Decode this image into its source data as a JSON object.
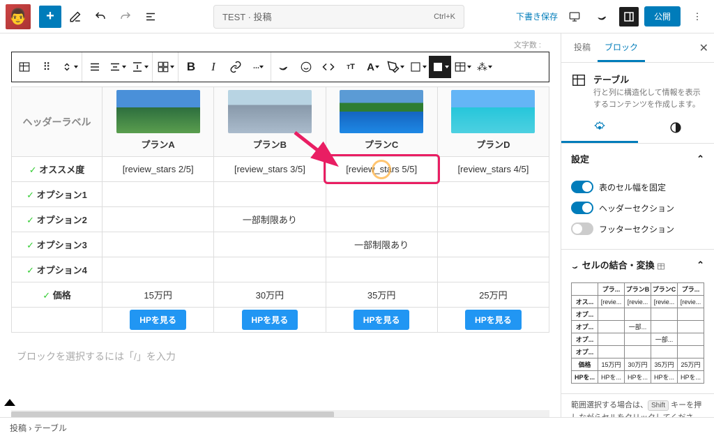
{
  "topbar": {
    "doc_title": "TEST · 投稿",
    "shortcut": "Ctrl+K",
    "draft_save": "下書き保存",
    "publish": "公開"
  },
  "wordcount_label": "文字数 :",
  "table": {
    "header_label": "ヘッダーラベル",
    "plans": [
      "プランA",
      "プランB",
      "プランC",
      "プランD"
    ],
    "rows": [
      {
        "label": "オススメ度",
        "cells": [
          "[review_stars 2/5]",
          "[review_stars 3/5]",
          "[review_stars 5/5]",
          "[review_stars 4/5]"
        ]
      },
      {
        "label": "オプション1",
        "cells": [
          "",
          "",
          "",
          ""
        ]
      },
      {
        "label": "オプション2",
        "cells": [
          "",
          "一部制限あり",
          "",
          ""
        ]
      },
      {
        "label": "オプション3",
        "cells": [
          "",
          "",
          "一部制限あり",
          ""
        ]
      },
      {
        "label": "オプション4",
        "cells": [
          "",
          "",
          "",
          ""
        ]
      },
      {
        "label": "価格",
        "cells": [
          "15万円",
          "30万円",
          "35万円",
          "25万円"
        ]
      }
    ],
    "cta": "HPを見る"
  },
  "placeholder": "ブロックを選択するには「/」を入力",
  "sidebar": {
    "tab_post": "投稿",
    "tab_block": "ブロック",
    "block_title": "テーブル",
    "block_desc": "行と列に構造化して情報を表示するコンテンツを作成します。",
    "panel_settings": "設定",
    "toggle_fixed": "表のセル幅を固定",
    "toggle_header": "ヘッダーセクション",
    "toggle_footer": "フッターセクション",
    "panel_merge": "セルの結合・変換",
    "mini": {
      "cols": [
        "",
        "プラ...",
        "プランB",
        "プランC",
        "プラ..."
      ],
      "rows": [
        [
          "オス...",
          "[revie...",
          "[revie...",
          "[revie...",
          "[revie..."
        ],
        [
          "オプ...",
          "",
          "",
          "",
          ""
        ],
        [
          "オプ...",
          "",
          "一部...",
          "",
          ""
        ],
        [
          "オプ...",
          "",
          "",
          "一部...",
          ""
        ],
        [
          "オプ...",
          "",
          "",
          "",
          ""
        ],
        [
          "価格",
          "15万円",
          "30万円",
          "35万円",
          "25万円"
        ],
        [
          "HPを...",
          "HPを...",
          "HPを...",
          "HPを...",
          "HPを..."
        ]
      ]
    },
    "hint_pre": "範囲選択する場合は、",
    "hint_key": "Shift",
    "hint_post": " キーを押しながらセルをクリックしてください。複数選択し"
  },
  "breadcrumb": {
    "post": "投稿",
    "table": "テーブル"
  }
}
